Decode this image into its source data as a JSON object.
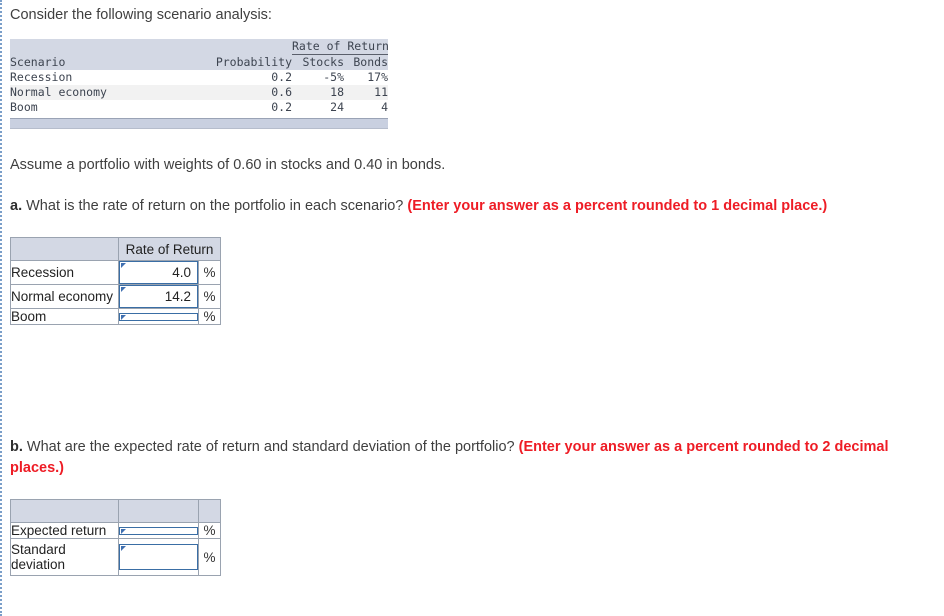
{
  "intro": "Consider the following scenario analysis:",
  "scenario_table": {
    "group_header": "Rate of Return",
    "columns": [
      "Scenario",
      "Probability",
      "Stocks",
      "Bonds"
    ],
    "rows": [
      {
        "scenario": "Recession",
        "probability": "0.2",
        "stocks": "-5%",
        "bonds": "17%"
      },
      {
        "scenario": "Normal economy",
        "probability": "0.6",
        "stocks": "18",
        "bonds": "11"
      },
      {
        "scenario": "Boom",
        "probability": "0.2",
        "stocks": "24",
        "bonds": "4"
      }
    ]
  },
  "assume_text": "Assume a portfolio with weights of 0.60 in stocks and 0.40 in bonds.",
  "question_a": {
    "label": "a.",
    "text": "What is the rate of return on the portfolio in each scenario?",
    "note": "(Enter your answer as a percent rounded to 1 decimal place.)"
  },
  "answer_table_a": {
    "corner_header": "",
    "value_header": "Rate of Return",
    "rows": [
      {
        "label": "Recession",
        "value": "4.0",
        "unit": "%"
      },
      {
        "label": "Normal economy",
        "value": "14.2",
        "unit": "%"
      },
      {
        "label": "Boom",
        "value": "",
        "unit": "%"
      }
    ]
  },
  "question_b": {
    "label": "b.",
    "text": "What are the expected rate of return and standard deviation of the portfolio?",
    "note": "(Enter your answer as a percent rounded to 2 decimal places.)"
  },
  "answer_table_b": {
    "corner_header": "",
    "value_header": "",
    "unit_header": "",
    "rows": [
      {
        "label": "Expected return",
        "value": "",
        "unit": "%"
      },
      {
        "label": "Standard deviation",
        "value": "",
        "unit": "%"
      }
    ]
  },
  "colors": {
    "header_band": "#d3d8e4",
    "row_stripe": "#f2f2f2",
    "input_border": "#3a6ea5",
    "red_note": "#ee1c25",
    "grid_line": "#9aa3b0",
    "left_rule": "#7a9ec9"
  }
}
